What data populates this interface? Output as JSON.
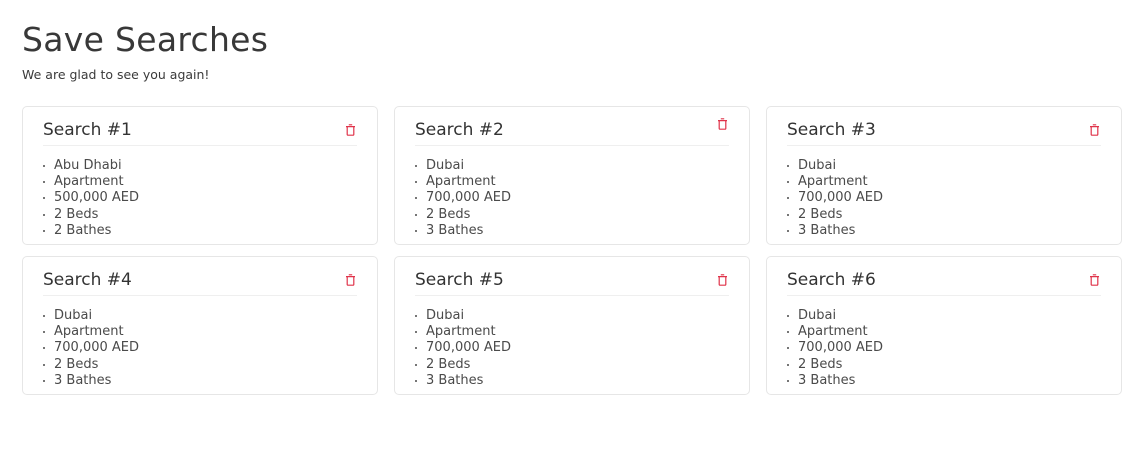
{
  "header": {
    "title": "Save Searches",
    "subtitle": "We are glad to see you again!"
  },
  "colors": {
    "delete_icon": "#e0334a",
    "card_border": "#e6e6e6"
  },
  "searches": [
    {
      "title": "Search #1",
      "items": [
        "Abu Dhabi",
        "Apartment",
        "500,000 AED",
        "2 Beds",
        "2 Bathes"
      ],
      "action_icon": "trash-icon"
    },
    {
      "title": "Search #2",
      "items": [
        "Dubai",
        "Apartment",
        "700,000 AED",
        "2 Beds",
        "3 Bathes"
      ],
      "action_icon": "trash-icon"
    },
    {
      "title": "Search #3",
      "items": [
        "Dubai",
        "Apartment",
        "700,000 AED",
        "2 Beds",
        "3 Bathes"
      ],
      "action_icon": "trash-icon"
    },
    {
      "title": "Search #4",
      "items": [
        "Dubai",
        "Apartment",
        "700,000 AED",
        "2 Beds",
        "3 Bathes"
      ],
      "action_icon": "trash-icon"
    },
    {
      "title": "Search #5",
      "items": [
        "Dubai",
        "Apartment",
        "700,000 AED",
        "2 Beds",
        "3 Bathes"
      ],
      "action_icon": "trash-icon"
    },
    {
      "title": "Search #6",
      "items": [
        "Dubai",
        "Apartment",
        "700,000 AED",
        "2 Beds",
        "3 Bathes"
      ],
      "action_icon": "trash-icon"
    }
  ]
}
